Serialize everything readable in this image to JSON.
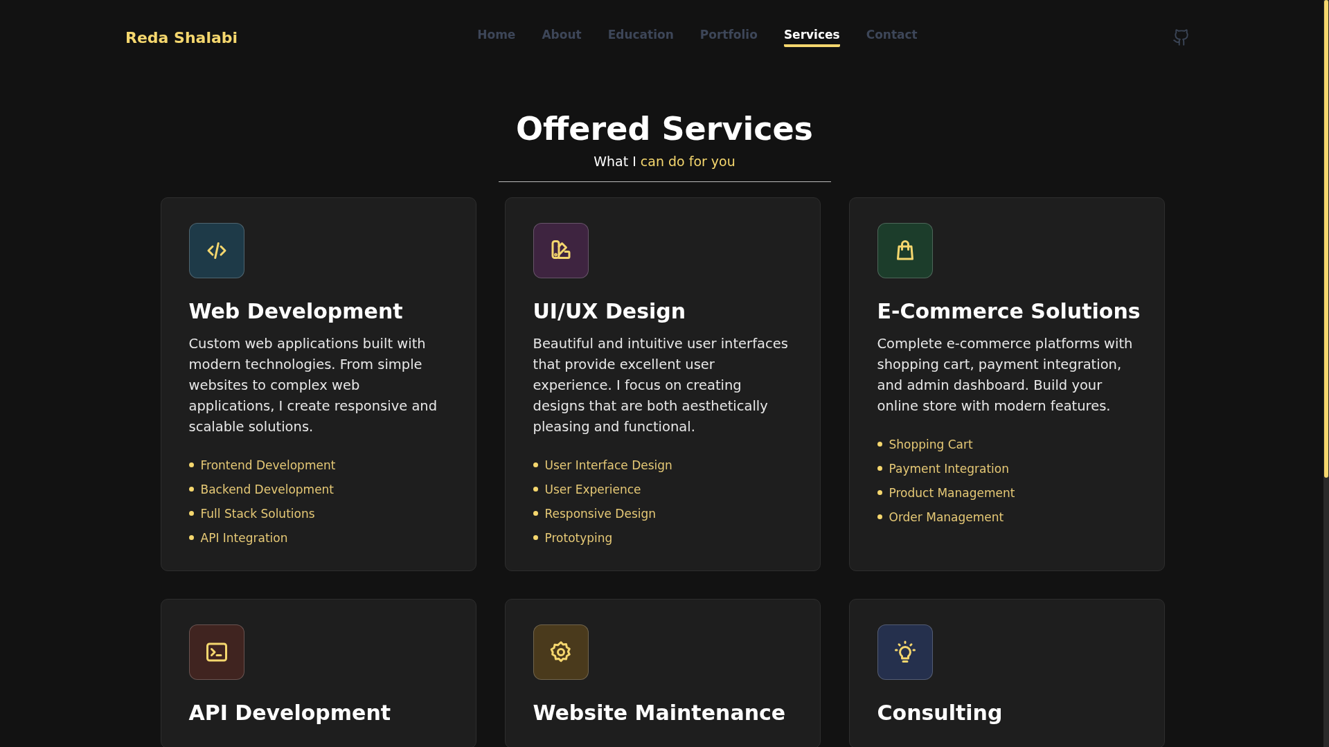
{
  "header": {
    "logo": "Reda Shalabi",
    "nav": [
      {
        "label": "Home",
        "selected": false
      },
      {
        "label": "About",
        "selected": false
      },
      {
        "label": "Education",
        "selected": false
      },
      {
        "label": "Portfolio",
        "selected": false
      },
      {
        "label": "Services",
        "selected": true
      },
      {
        "label": "Contact",
        "selected": false
      }
    ]
  },
  "section": {
    "title": "Offered Services",
    "subtitle_lead": "What I",
    "subtitle_highlight": "can do for you"
  },
  "services": [
    {
      "kind": "code",
      "color": "#1e3a48",
      "title": "Web Development",
      "description": "Custom web applications built with modern technologies. From simple websites to complex web applications, I create responsive and scalable solutions.",
      "features": [
        "Frontend Development",
        "Backend Development",
        "Full Stack Solutions",
        "API Integration"
      ]
    },
    {
      "kind": "swatch",
      "color": "#3e2440",
      "title": "UI/UX Design",
      "description": "Beautiful and intuitive user interfaces that provide excellent user experience. I focus on creating designs that are both aesthetically pleasing and functional.",
      "features": [
        "User Interface Design",
        "User Experience",
        "Responsive Design",
        "Prototyping"
      ]
    },
    {
      "kind": "bag",
      "color": "#1c3d2b",
      "title": "E-Commerce Solutions",
      "description": "Complete e-commerce platforms with shopping cart, payment integration, and admin dashboard. Build your online store with modern features.",
      "features": [
        "Shopping Cart",
        "Payment Integration",
        "Product Management",
        "Order Management"
      ]
    },
    {
      "kind": "terminal",
      "color": "#402420",
      "title": "API Development"
    },
    {
      "kind": "gear",
      "color": "#4a3a1c",
      "title": "Website Maintenance"
    },
    {
      "kind": "bulb",
      "color": "#25304d",
      "title": "Consulting"
    }
  ]
}
